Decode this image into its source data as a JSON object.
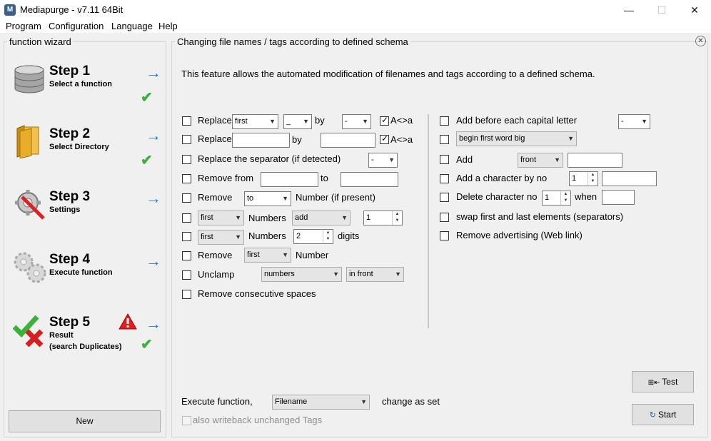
{
  "window": {
    "title": "Mediapurge - v7.11 64Bit",
    "minimize": "—",
    "maximize": "☐",
    "close": "✕"
  },
  "menu": [
    "Program",
    "Configuration",
    "Language",
    "Help"
  ],
  "wizard": {
    "label": "function wizard",
    "steps": [
      {
        "title": "Step 1",
        "sub": [
          "Select a function"
        ],
        "icon": "database-icon",
        "done": true
      },
      {
        "title": "Step 2",
        "sub": [
          "Select Directory"
        ],
        "icon": "folder-icon",
        "done": true
      },
      {
        "title": "Step 3",
        "sub": [
          "Settings"
        ],
        "icon": "settings-tools-icon",
        "done": false
      },
      {
        "title": "Step 4",
        "sub": [
          "Execute function"
        ],
        "icon": "gears-icon",
        "done": false
      },
      {
        "title": "Step 5",
        "sub": [
          "Result",
          "(search Duplicates)"
        ],
        "icon": "result-check-cross-icon",
        "done": true,
        "warning": true
      }
    ],
    "new_button": "New"
  },
  "panel": {
    "title": "Changing file names / tags according to defined schema",
    "description": "This feature allows the automated modification of filenames and tags according to a defined schema.",
    "left": {
      "replace1": {
        "label": "Replace",
        "mode": "first",
        "char": "_",
        "by": "by",
        "with": "-",
        "case_label": "A<>a",
        "case_checked": true
      },
      "replace2": {
        "label": "Replace",
        "by": "by",
        "case_label": "A<>a",
        "case_checked": true
      },
      "separator": {
        "label": "Replace the separator (if detected)",
        "value": "-"
      },
      "remove_from": {
        "label": "Remove from",
        "to": "to"
      },
      "remove_number": {
        "label": "Remove",
        "mode": "to",
        "suffix": "Number (if present)"
      },
      "numbers1": {
        "mode": "first",
        "label": "Numbers",
        "action": "add",
        "value": "1"
      },
      "numbers2": {
        "mode": "first",
        "label": "Numbers",
        "value": "2",
        "suffix": "digits"
      },
      "remove_first": {
        "label": "Remove",
        "mode": "first",
        "suffix": "Number"
      },
      "unclamp": {
        "label": "Unclamp",
        "what": "numbers",
        "where": "in front"
      },
      "consecutive": {
        "label": "Remove consecutive spaces"
      }
    },
    "right": {
      "capital": {
        "label": "Add before each capital letter",
        "value": "-"
      },
      "first_word": {
        "value": "begin first word big"
      },
      "add": {
        "label": "Add",
        "where": "front"
      },
      "add_char": {
        "label": "Add a character by no",
        "value": "1"
      },
      "delete_char": {
        "label": "Delete character no",
        "value": "1",
        "when": "when"
      },
      "swap": {
        "label": "swap first and last elements (separators)"
      },
      "advertising": {
        "label": "Remove advertising (Web link)"
      }
    },
    "execute": {
      "label": "Execute function,",
      "value": "Filename",
      "suffix": "change as set"
    },
    "writeback": {
      "label": "also writeback unchanged Tags"
    },
    "test_button": "Test",
    "start_button": "Start"
  }
}
